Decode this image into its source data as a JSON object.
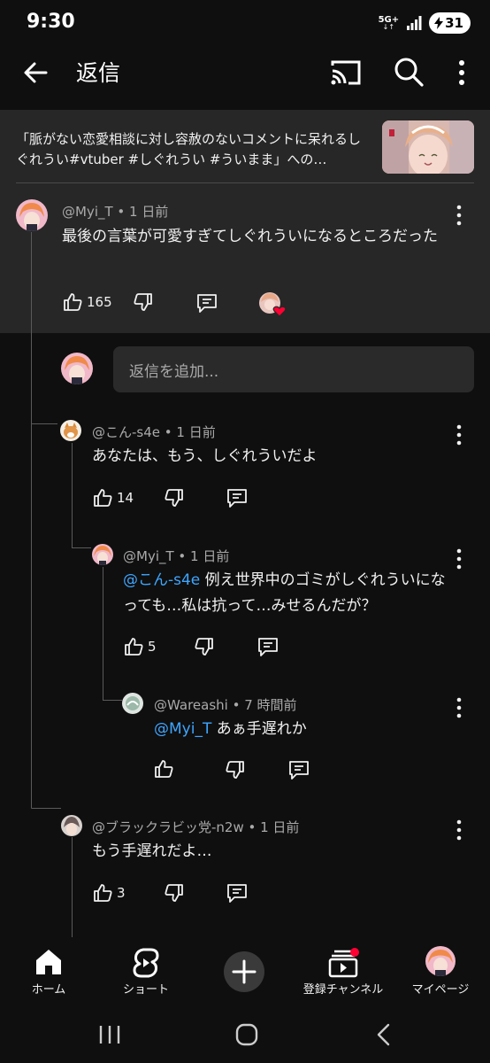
{
  "status_bar": {
    "time": "9:30",
    "network": "5G+",
    "battery": "31"
  },
  "app_bar": {
    "title": "返信"
  },
  "video_ref": {
    "text": "「脈がない恋愛相談に対し容赦のないコメントに呆れるしぐれうい#vtuber #しぐれうい #ういまま」への…"
  },
  "parent_comment": {
    "author": "@Myi_T",
    "time": "1 日前",
    "text": "最後の言葉が可愛すぎてしぐれういになるところだった",
    "likes": "165"
  },
  "reply_input": {
    "placeholder": "返信を追加..."
  },
  "replies": [
    {
      "author": "@こん-s4e",
      "time": "1 日前",
      "mention": "",
      "text": "あなたは、もう、しぐれういだよ",
      "likes": "14"
    },
    {
      "author": "@Myi_T",
      "time": "1 日前",
      "mention": "@こん-s4e",
      "text": " 例え世界中のゴミがしぐれういになっても…私は抗って…みせるんだが？",
      "likes": "5"
    },
    {
      "author": "@Wareashi",
      "time": "7 時間前",
      "mention": "@Myi_T",
      "text": " あぁ手遅れか",
      "likes": ""
    },
    {
      "author": "@ブラックラビッ党-n2w",
      "time": "1 日前",
      "mention": "",
      "text": "もう手遅れだよ…",
      "likes": "3"
    }
  ],
  "bottom_nav": {
    "home": "ホーム",
    "shorts": "ショート",
    "subscriptions": "登録チャンネル",
    "you": "マイページ"
  },
  "colors": {
    "background": "#0f0f0f",
    "surface": "#272727",
    "mention": "#3ea6ff",
    "badge": "#ff0033"
  }
}
